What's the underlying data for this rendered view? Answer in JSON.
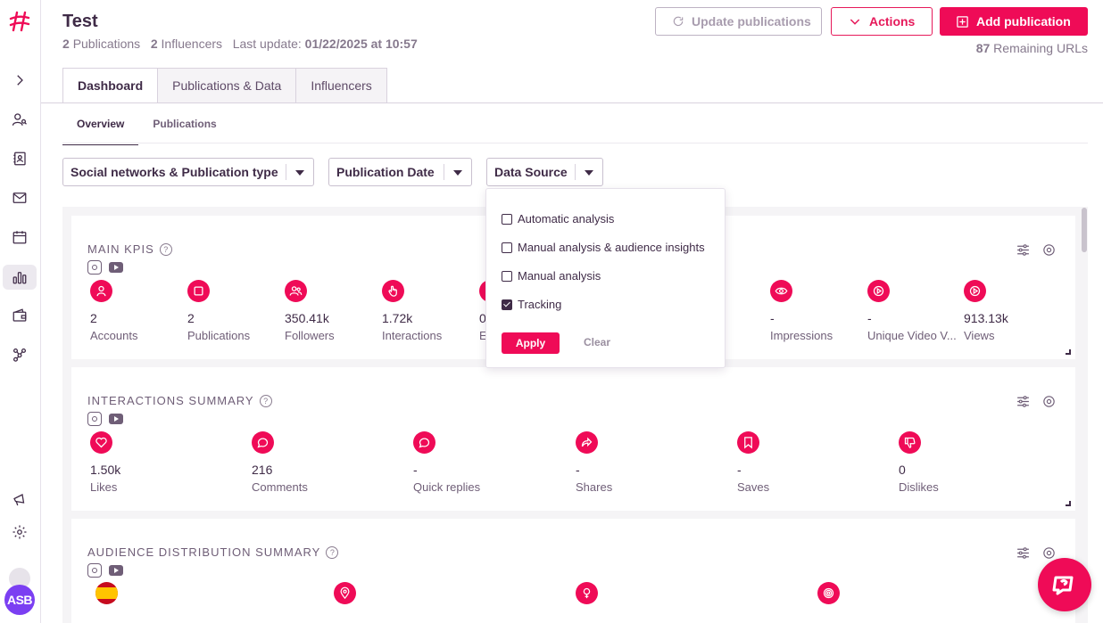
{
  "header": {
    "title": "Test",
    "publications_count": "2",
    "publications_label": "Publications",
    "influencers_count": "2",
    "influencers_label": "Influencers",
    "last_update_label": "Last update:",
    "last_update_value": "01/22/2025 at 10:57",
    "update_button": "Update publications",
    "actions_button": "Actions",
    "add_button": "Add publication",
    "remaining_count": "87",
    "remaining_label": "Remaining URLs"
  },
  "tabs": [
    "Dashboard",
    "Publications & Data",
    "Influencers"
  ],
  "subtabs": [
    "Overview",
    "Publications"
  ],
  "filters": [
    "Social networks & Publication type",
    "Publication Date",
    "Data Source"
  ],
  "data_source_dropdown": {
    "options": [
      {
        "label": "Automatic analysis",
        "checked": false
      },
      {
        "label": "Manual analysis & audience insights",
        "checked": false
      },
      {
        "label": "Manual analysis",
        "checked": false
      },
      {
        "label": "Tracking",
        "checked": true
      }
    ],
    "apply": "Apply",
    "clear": "Clear"
  },
  "sidebar": {
    "avatar_initials": "ASB",
    "icons": [
      "logo-icon",
      "expand-icon",
      "user-search-icon",
      "contacts-icon",
      "mail-icon",
      "calendar-icon",
      "bar-chart-icon",
      "wallet-icon",
      "network-icon",
      "megaphone-icon",
      "gear-icon"
    ]
  },
  "main_kpis": {
    "title": "MAIN KPIS",
    "items": [
      {
        "icon": "user-icon",
        "value": "2",
        "label": "Accounts"
      },
      {
        "icon": "publication-icon",
        "value": "2",
        "label": "Publications"
      },
      {
        "icon": "followers-icon",
        "value": "350.41k",
        "label": "Followers"
      },
      {
        "icon": "hand-pointer-icon",
        "value": "1.72k",
        "label": "Interactions"
      },
      {
        "icon": "engagement-icon",
        "value": "0",
        "label": "E"
      },
      {
        "icon": "eye-icon",
        "value": "-",
        "label": "Impressions"
      },
      {
        "icon": "play-icon",
        "value": "-",
        "label": "Unique Video V..."
      },
      {
        "icon": "play-icon",
        "value": "913.13k",
        "label": "Views"
      }
    ]
  },
  "interactions_summary": {
    "title": "INTERACTIONS SUMMARY",
    "items": [
      {
        "icon": "heart-icon",
        "value": "1.50k",
        "label": "Likes"
      },
      {
        "icon": "comment-icon",
        "value": "216",
        "label": "Comments"
      },
      {
        "icon": "quick-reply-icon",
        "value": "-",
        "label": "Quick replies"
      },
      {
        "icon": "share-icon",
        "value": "-",
        "label": "Shares"
      },
      {
        "icon": "bookmark-icon",
        "value": "-",
        "label": "Saves"
      },
      {
        "icon": "thumbs-down-icon",
        "value": "0",
        "label": "Dislikes"
      }
    ]
  },
  "audience_summary": {
    "title": "AUDIENCE DISTRIBUTION SUMMARY"
  },
  "colors": {
    "accent": "#ef0b57",
    "text": "#3f2b47",
    "avatar": "#7b3ff2"
  }
}
